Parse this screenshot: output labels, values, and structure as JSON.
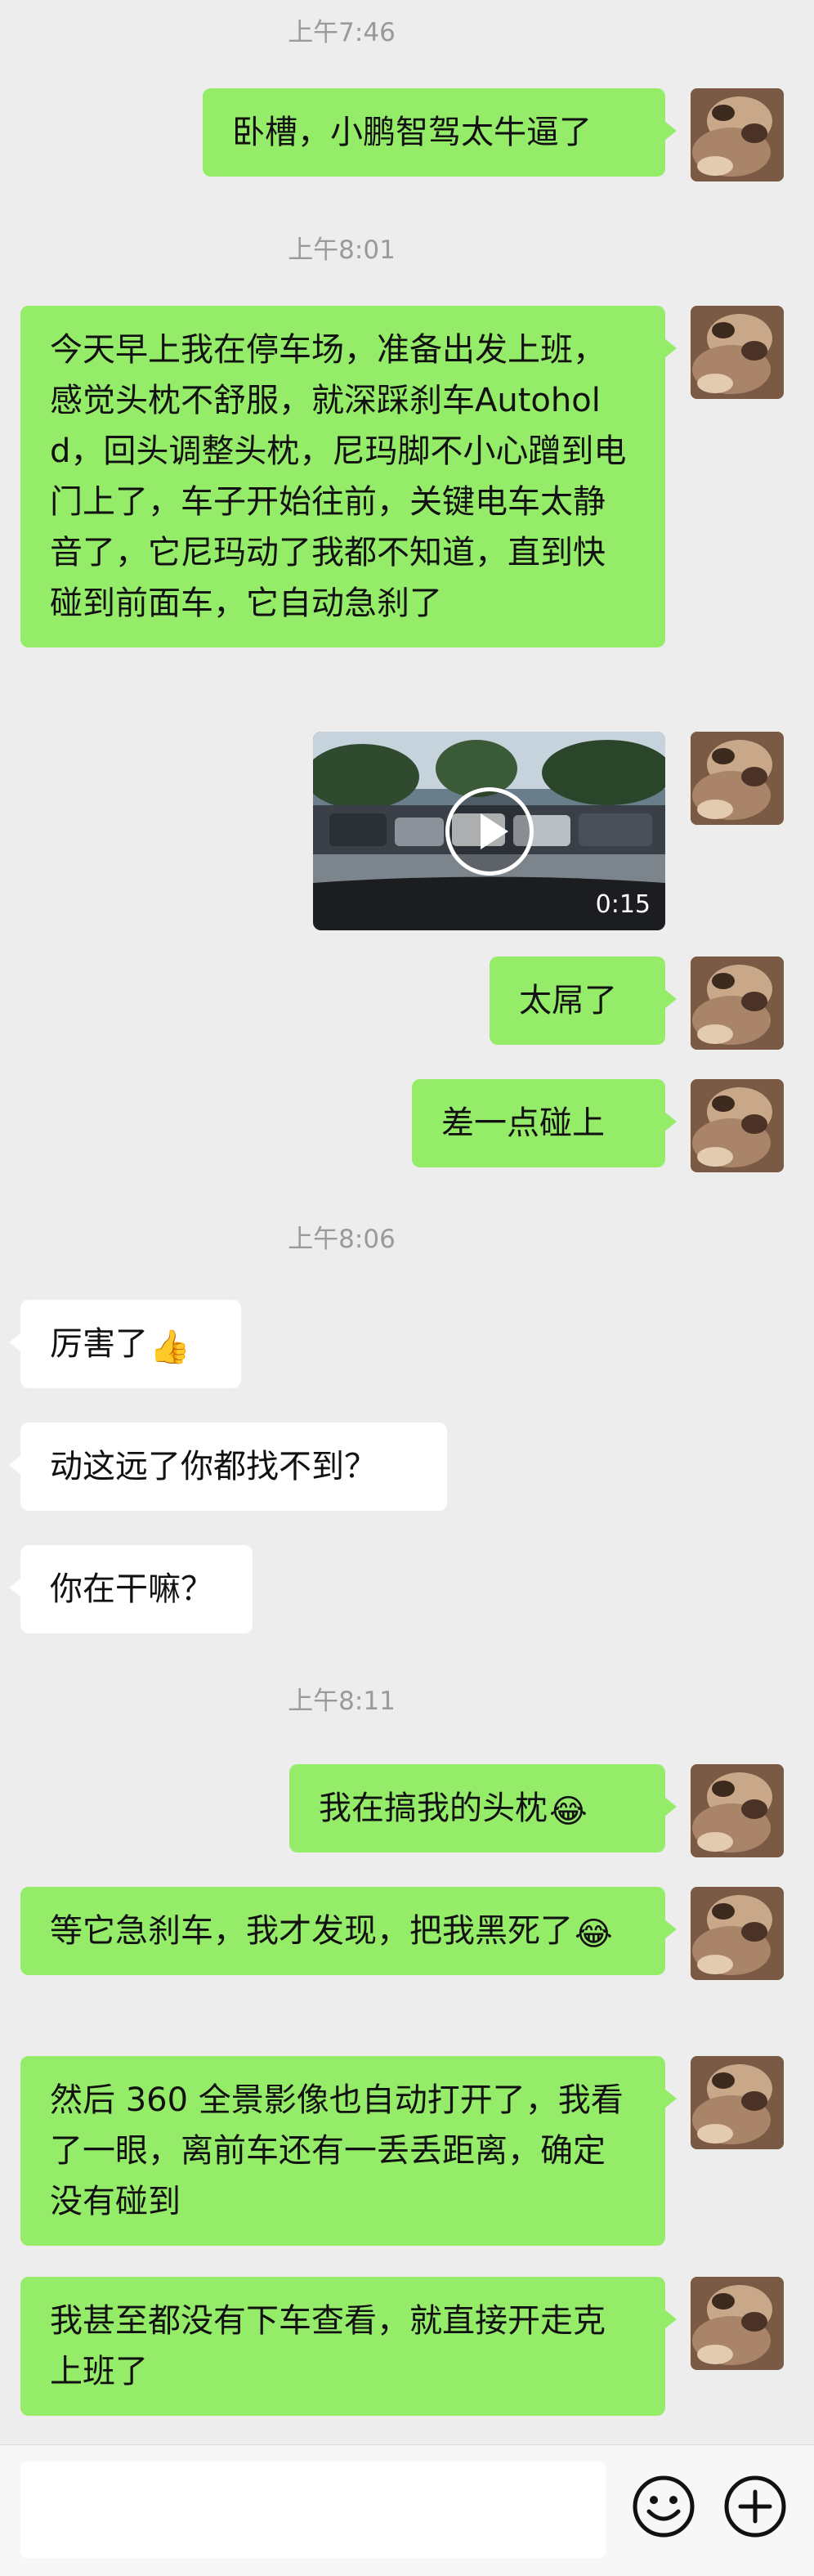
{
  "chat": {
    "timestamps": [
      "上午7:46",
      "上午8:01",
      "上午8:06",
      "上午8:11"
    ],
    "messages": [
      {
        "side": "out",
        "text": "卧槽，小鹏智驾太牛逼了"
      },
      {
        "side": "out",
        "text": "今天早上我在停车场，准备出发上班，感觉头枕不舒服，就深踩刹车Autohold，回头调整头枕，尼玛脚不小心蹭到电门上了，车子开始往前，关键电车太静音了，它尼玛动了我都不知道，直到快碰到前面车，它自动急刹了"
      },
      {
        "side": "out",
        "type": "video",
        "duration": "0:15"
      },
      {
        "side": "out",
        "text": "太屌了"
      },
      {
        "side": "out",
        "text": "差一点碰上"
      },
      {
        "side": "in",
        "text": "厉害了",
        "emoji": "👍"
      },
      {
        "side": "in",
        "text": "动这远了你都找不到？"
      },
      {
        "side": "in",
        "text": "你在干嘛？"
      },
      {
        "side": "out",
        "text": "我在搞我的头枕",
        "emoji": "😂"
      },
      {
        "side": "out",
        "text": "等它急刹车，我才发现，把我黑死了",
        "emoji": "😂"
      },
      {
        "side": "out",
        "text": "然后 360 全景影像也自动打开了，我看了一眼，离前车还有一丢丢距离，确定没有碰到"
      },
      {
        "side": "out",
        "text": "我甚至都没有下车查看，就直接开走克上班了"
      }
    ]
  },
  "input_bar": {
    "message_value": "",
    "icons": [
      "emoji-icon",
      "add-icon"
    ]
  },
  "colors": {
    "background": "#ededed",
    "outgoing_bubble": "#95ec69",
    "incoming_bubble": "#ffffff",
    "timestamp": "#9a9a9a"
  }
}
